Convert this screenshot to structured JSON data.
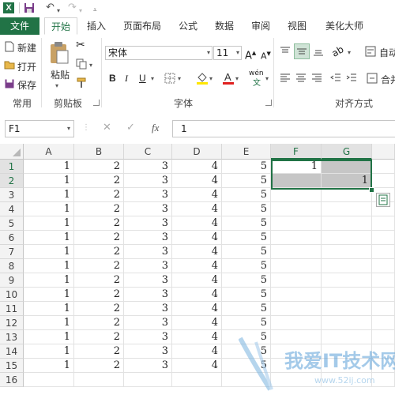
{
  "titlebar": {
    "app_logo": "X"
  },
  "tabs": [
    "文件",
    "开始",
    "插入",
    "页面布局",
    "公式",
    "数据",
    "审阅",
    "视图",
    "美化大师"
  ],
  "ribbon": {
    "common": {
      "new": "新建",
      "open": "打开",
      "save": "保存",
      "label": "常用"
    },
    "clipboard": {
      "paste": "粘贴",
      "label": "剪贴板"
    },
    "font": {
      "name": "宋体",
      "size": "11",
      "bold": "B",
      "italic": "I",
      "underline": "U",
      "phonetic": "wén",
      "label": "字体"
    },
    "align": {
      "auto_wrap": "自动",
      "merge": "合并",
      "label": "对齐方式"
    }
  },
  "formula_bar": {
    "name_box": "F1",
    "fx": "fx",
    "value": "1"
  },
  "columns": [
    "A",
    "B",
    "C",
    "D",
    "E",
    "F",
    "G"
  ],
  "rows": [
    "1",
    "2",
    "3",
    "4",
    "5",
    "6",
    "7",
    "8",
    "9",
    "10",
    "11",
    "12",
    "13",
    "14",
    "15",
    "16"
  ],
  "cells": {
    "row_values": [
      "1",
      "2",
      "3",
      "4",
      "5"
    ],
    "F1": "1",
    "G2": "1"
  },
  "watermark": {
    "text": "我爱IT技术网",
    "url": "www.52ij.com"
  },
  "colors": {
    "accent": "#217346",
    "selection_shade": "#c6c6c6"
  }
}
